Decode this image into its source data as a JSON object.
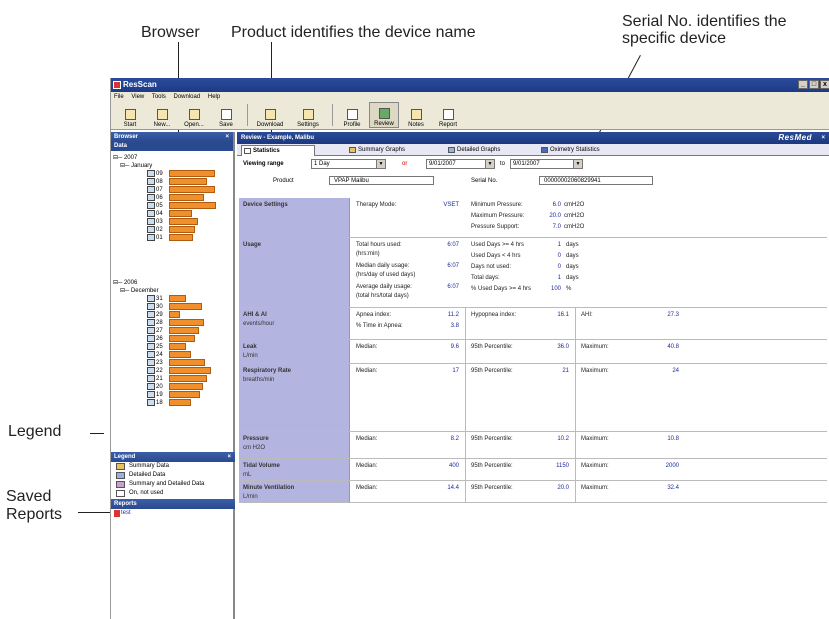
{
  "callouts": {
    "browser": "Browser",
    "product": "Product identifies the device name",
    "serial": "Serial No. identifies the\nspecific device",
    "legend": "Legend",
    "saved_reports_line1": "Saved",
    "saved_reports_line2": "Reports"
  },
  "window": {
    "title": "ResScan",
    "min": "_",
    "max": "□",
    "close": "x"
  },
  "menu": [
    "File",
    "View",
    "Tools",
    "Download",
    "Help"
  ],
  "toolbar": [
    {
      "label": "Start",
      "icon": "start-icon"
    },
    {
      "label": "New...",
      "icon": "new-icon"
    },
    {
      "label": "Open...",
      "icon": "open-icon"
    },
    {
      "label": "Save",
      "icon": "save-icon"
    },
    {
      "label": "Download",
      "icon": "download-icon"
    },
    {
      "label": "Settings",
      "icon": "settings-icon"
    },
    {
      "label": "Profile",
      "icon": "profile-icon"
    },
    {
      "label": "Review",
      "icon": "review-icon"
    },
    {
      "label": "Notes",
      "icon": "notes-icon"
    },
    {
      "label": "Report",
      "icon": "report-icon"
    }
  ],
  "browser": {
    "title": "Browser",
    "close": "×",
    "data_label": "Data",
    "year_2007": "2007",
    "month_january": "January",
    "year_2006": "2006",
    "month_december": "December",
    "jan_days": [
      {
        "day": "09",
        "usage": 0.95
      },
      {
        "day": "08",
        "usage": 0.8
      },
      {
        "day": "07",
        "usage": 0.95
      },
      {
        "day": "06",
        "usage": 0.72
      },
      {
        "day": "05",
        "usage": 0.97
      },
      {
        "day": "04",
        "usage": 0.48
      },
      {
        "day": "03",
        "usage": 0.6
      },
      {
        "day": "02",
        "usage": 0.55
      },
      {
        "day": "01",
        "usage": 0.5
      }
    ],
    "dec_days": [
      {
        "day": "31",
        "usage": 0.35
      },
      {
        "day": "30",
        "usage": 0.68
      },
      {
        "day": "29",
        "usage": 0.22
      },
      {
        "day": "28",
        "usage": 0.72
      },
      {
        "day": "27",
        "usage": 0.62
      },
      {
        "day": "26",
        "usage": 0.55
      },
      {
        "day": "25",
        "usage": 0.35
      },
      {
        "day": "24",
        "usage": 0.45
      },
      {
        "day": "23",
        "usage": 0.75
      },
      {
        "day": "22",
        "usage": 0.88
      },
      {
        "day": "21",
        "usage": 0.8
      },
      {
        "day": "20",
        "usage": 0.7
      },
      {
        "day": "19",
        "usage": 0.65
      },
      {
        "day": "18",
        "usage": 0.45
      }
    ]
  },
  "legend": {
    "title": "Legend",
    "close": "×",
    "items": [
      "Summary Data",
      "Detailed Data",
      "Summary and Detailed Data",
      "On, not used"
    ]
  },
  "reports": {
    "title": "Reports",
    "items": [
      "test"
    ]
  },
  "review": {
    "title": "Review - Example, Malibu",
    "brand": "ResMed",
    "close": "×",
    "tabs": [
      "Statistics",
      "Summary Graphs",
      "Detailed Graphs",
      "Oximetry Statistics"
    ],
    "viewing_range_label": "Viewing range",
    "viewing_range_value": "1 Day",
    "or_label": "or",
    "from_date": "9/01/2007",
    "to_label": "to",
    "to_date": "9/01/2007",
    "product_label": "Product",
    "product_value": "VPAP Malibu",
    "serial_label": "Serial No.",
    "serial_value": "00000002060829941"
  },
  "stats": {
    "device_settings": {
      "title": "Device Settings",
      "therapy_mode_label": "Therapy Mode:",
      "therapy_mode_value": "VSET",
      "min_pressure_label": "Minimum Pressure:",
      "min_pressure_value": "6.0",
      "max_pressure_label": "Maximum Pressure:",
      "max_pressure_value": "20.0",
      "pressure_support_label": "Pressure Support:",
      "pressure_support_value": "7.0",
      "unit_cmh2o": "cmH2O"
    },
    "usage": {
      "title": "Usage",
      "total_hours_label": "Total hours used:",
      "total_hours_sub": "(hrs:min)",
      "total_hours_value": "6:07",
      "median_label": "Median daily usage:",
      "median_sub": "(hrs/day of used days)",
      "median_value": "6:07",
      "average_label": "Average daily usage:",
      "average_sub": "(total hrs/total days)",
      "average_value": "6:07",
      "days_ge4_label": "Used Days >= 4 hrs",
      "days_ge4_value": "1",
      "days_lt4_label": "Used Days < 4 hrs",
      "days_lt4_value": "0",
      "not_used_label": "Days not used:",
      "not_used_value": "0",
      "total_days_label": "Total days:",
      "total_days_value": "1",
      "pct_label": "% Used Days >= 4 hrs",
      "pct_value": "100",
      "days_unit": "days",
      "pct_unit": "%"
    },
    "ahi": {
      "title": "AHI & AI",
      "unit": "events/hour",
      "apnea_label": "Apnea index:",
      "apnea_value": "11.2",
      "time_apnea_label": "% Time in Apnea:",
      "time_apnea_value": "3.8",
      "hypopnea_label": "Hypopnea index:",
      "hypopnea_value": "16.1",
      "ahi_label": "AHI:",
      "ahi_value": "27.3"
    },
    "leak": {
      "title": "Leak",
      "unit": "L/min",
      "median": "9.6",
      "p95": "36.0",
      "max": "40.8"
    },
    "resp_rate": {
      "title": "Respiratory Rate",
      "unit": "breaths/min",
      "median": "17",
      "p95": "21",
      "max": "24"
    },
    "pressure": {
      "title": "Pressure",
      "unit": "cm H2O",
      "median": "8.2",
      "p95": "10.2",
      "max": "10.8"
    },
    "tidal_volume": {
      "title": "Tidal Volume",
      "unit": "mL",
      "median": "400",
      "p95": "1150",
      "max": "2000"
    },
    "minute_vent": {
      "title": "Minute Ventilation",
      "unit": "L/min",
      "median": "14.4",
      "p95": "20.0",
      "max": "32.4"
    },
    "median_label": "Median:",
    "p95_label": "95th Percentile:",
    "max_label": "Maximum:"
  }
}
